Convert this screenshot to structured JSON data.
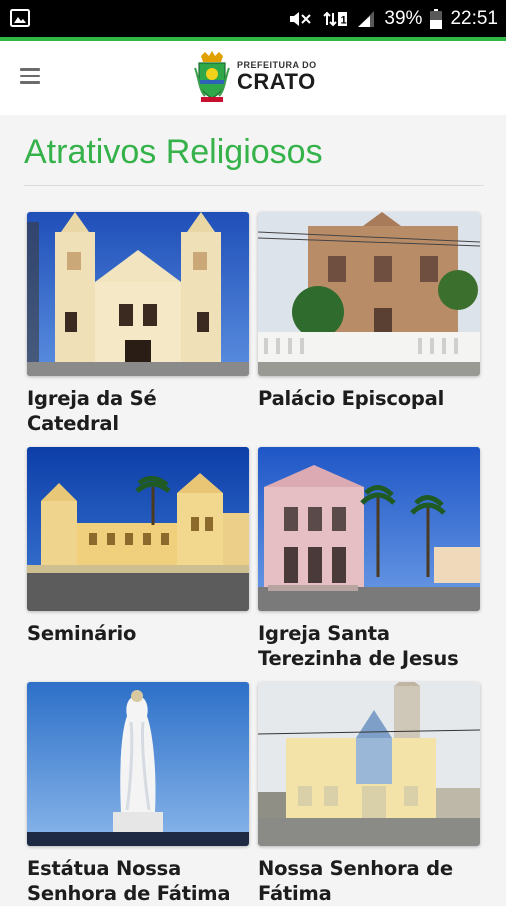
{
  "status_bar": {
    "battery_percent": "39%",
    "time": "22:51"
  },
  "header": {
    "logo_top": "PREFEITURA DO",
    "logo_bottom": "CRATO"
  },
  "page": {
    "title": "Atrativos Religiosos"
  },
  "attractions": [
    {
      "name": "Igreja da Sé Catedral"
    },
    {
      "name": "Palácio Episcopal"
    },
    {
      "name": "Seminário"
    },
    {
      "name": "Igreja Santa Terezinha de Jesus"
    },
    {
      "name": "Estátua Nossa Senhora de Fátima"
    },
    {
      "name": "Nossa Senhora de Fátima"
    }
  ],
  "colors": {
    "accent": "#35b24a",
    "status_line": "#2fb944"
  }
}
